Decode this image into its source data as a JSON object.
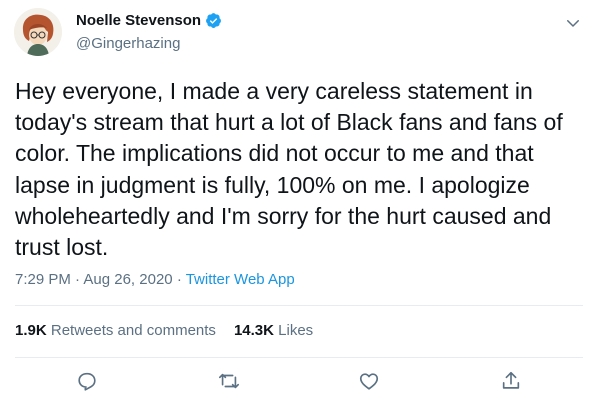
{
  "author": {
    "name": "Noelle Stevenson",
    "handle": "@Gingerhazing",
    "verified": true
  },
  "tweet": {
    "text": "Hey everyone, I made a very careless statement in today's stream that hurt a lot of Black fans and fans of color. The implications did not occur to me and that lapse in judgment is fully, 100% on me. I apologize wholeheartedly and I'm sorry for the hurt caused and trust lost.",
    "time": "7:29 PM",
    "date": "Aug 26, 2020",
    "separator": "·",
    "source": "Twitter Web App"
  },
  "stats": {
    "retweets_count": "1.9K",
    "retweets_label": "Retweets and comments",
    "likes_count": "14.3K",
    "likes_label": "Likes"
  },
  "icons": {
    "menu": "chevron-down-icon",
    "reply": "reply-icon",
    "retweet": "retweet-icon",
    "like": "heart-icon",
    "share": "share-icon",
    "verified": "verified-badge-icon"
  },
  "colors": {
    "accent": "#1b95e0",
    "verified": "#1da1f2",
    "muted": "#5b7083",
    "text": "#0f1419"
  }
}
